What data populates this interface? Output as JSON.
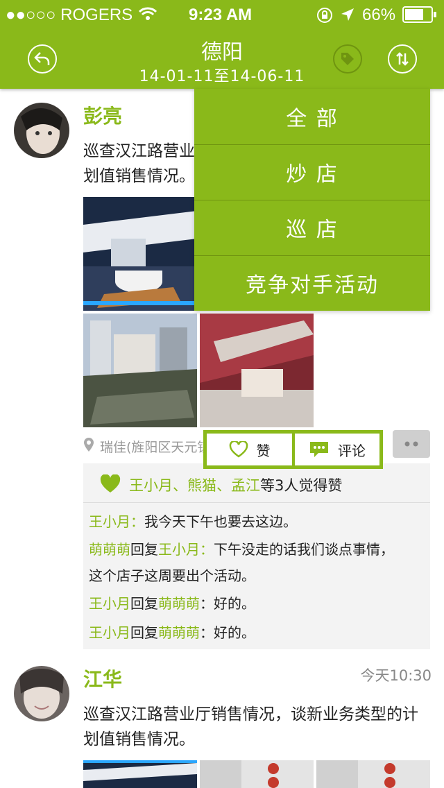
{
  "status": {
    "carrier": "●●○○○ ROGERS",
    "time": "9:23 AM",
    "battery": "66%"
  },
  "header": {
    "title": "德阳",
    "date_range": "14-01-11至14-06-11"
  },
  "icons": {
    "back": "back-arrow-icon",
    "tag": "tag-icon",
    "sort": "sort-arrows-icon"
  },
  "colors": {
    "accent": "#8ab91a",
    "accent_dark": "#6f9410"
  },
  "dropdown": {
    "items": [
      "全 部",
      "炒 店",
      "巡 店",
      "竞争对手活动"
    ]
  },
  "posts": [
    {
      "author": "彭亮",
      "text_line1": "巡查汉江路营业",
      "text_line2": "划值销售情况。",
      "location": "瑞佳(旌阳区天元镇",
      "actions": {
        "like": "赞",
        "comment": "评论"
      },
      "likes": {
        "names": "王小月、熊猫、孟江",
        "suffix": "等3人觉得赞"
      },
      "comments": [
        {
          "user": "王小月",
          "colon": "：",
          "text": "我今天下午也要去这边。"
        },
        {
          "user": "萌萌萌",
          "mid": "回复",
          "target": "王小月",
          "colon": "：",
          "text": "下午没走的话我们谈点事情，",
          "text2": "这个店子这周要出个活动。"
        },
        {
          "user": "王小月",
          "mid": "回复",
          "target": "萌萌萌",
          "colon": "：",
          "text": "好的。"
        },
        {
          "user": "王小月",
          "mid": "回复",
          "target": "萌萌萌",
          "colon": "：",
          "text": "好的。"
        }
      ]
    },
    {
      "author": "江华",
      "time": "今天10:30",
      "text_line1": "巡查汉江路营业厅销售情况，谈新业务类型的计",
      "text_line2": "划值销售情况。"
    }
  ]
}
